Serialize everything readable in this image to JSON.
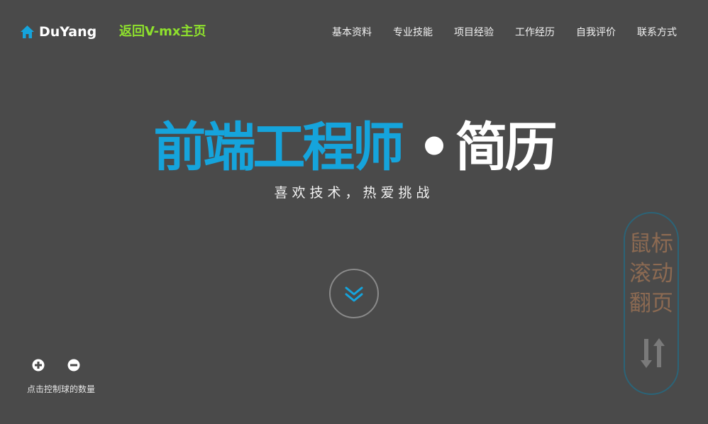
{
  "header": {
    "brand": "DuYang",
    "back_link": "返回V-mx主页",
    "nav": [
      {
        "label": "基本资料"
      },
      {
        "label": "专业技能"
      },
      {
        "label": "项目经验"
      },
      {
        "label": "工作经历"
      },
      {
        "label": "自我评价"
      },
      {
        "label": "联系方式"
      }
    ]
  },
  "hero": {
    "title_highlight": "前端工程师",
    "title_separator": "•",
    "title_rest": "简历",
    "subtitle": "喜欢技术，热爱挑战"
  },
  "ball_controls": {
    "caption": "点击控制球的数量"
  },
  "scroll_hint": {
    "line1": "鼠标",
    "line2": "滚动",
    "line3": "翻页"
  },
  "icons": {
    "home": "home-icon",
    "scroll_down": "double-chevron-down-icon",
    "plus": "plus-circle-icon",
    "minus": "minus-circle-icon",
    "swap": "up-down-arrows-icon"
  },
  "colors": {
    "background": "#4a4a4a",
    "accent_blue": "#15a4dc",
    "link_green": "#8ee02d",
    "hint_text": "#8c6a52",
    "hint_border": "#2b6478"
  }
}
